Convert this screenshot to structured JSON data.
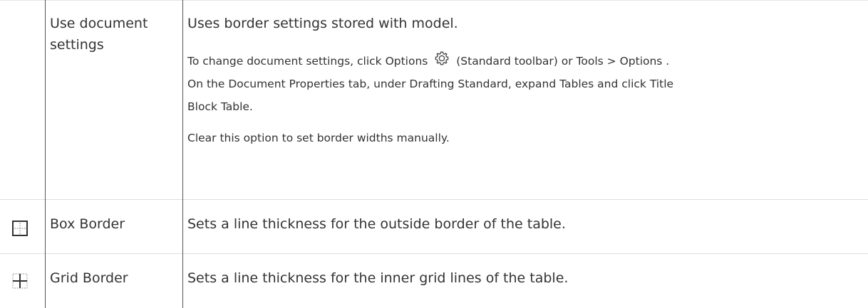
{
  "rows": [
    {
      "name_lines": [
        "Use document",
        "settings"
      ],
      "description": "Uses border settings stored with model.",
      "paragraphs": [
        {
          "before_icon": "To change document settings, click Options",
          "icon": "gear-icon",
          "after_icon_line1": "(Standard toolbar) or Tools > Options .",
          "line2": "On the Document Properties tab, under Drafting Standard, expand Tables and click Title",
          "line3": "Block Table."
        },
        {
          "text": "Clear this option to set border widths manually."
        }
      ]
    },
    {
      "icon": "box-border-icon",
      "name": "Box Border",
      "description": "Sets a line thickness for the outside border of the table."
    },
    {
      "icon": "grid-border-icon",
      "name": "Grid Border",
      "description": "Sets a line thickness for the inner grid lines of the table."
    }
  ],
  "colors": {
    "text": "#333333",
    "column_divider": "#555555",
    "row_divider": "#dedede",
    "icon_gray": "#8a8a8a",
    "icon_dark": "#333333"
  }
}
